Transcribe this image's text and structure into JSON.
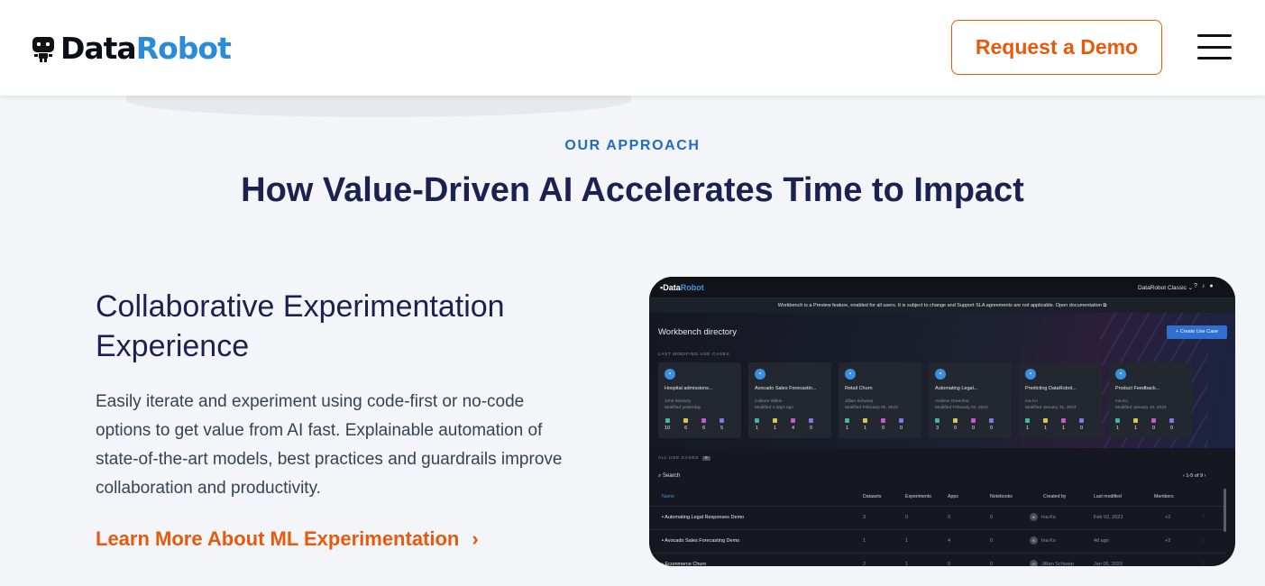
{
  "header": {
    "logo_data": "Data",
    "logo_robot": "Robot",
    "demo_button": "Request a Demo"
  },
  "section": {
    "eyebrow": "OUR APPROACH",
    "heading": "How Value-Driven AI Accelerates Time to Impact"
  },
  "feature": {
    "title": "Collaborative Experimentation Experience",
    "body": "Easily iterate and experiment using code-first or no-code options to get value from AI fast. Explainable automation of state-of-the-art models, best practices and guardrails improve collaboration and productivity.",
    "link": "Learn More About ML Experimentation",
    "link_chevron": "›"
  },
  "screenshot": {
    "logo_data": "Data",
    "logo_robot": "Robot",
    "classic": "DataRobot Classic ⌄",
    "banner": "Workbench is a Preview feature, enabled for all users. It is subject to change and Support SLA agreements are not applicable.    Open documentation ⧉",
    "title": "Workbench directory",
    "create_button": "+  Create Use Case",
    "last_modified_label": "LAST MODIFIED USE CASES",
    "cards": [
      {
        "name": "Hospital admissions...",
        "owner": "John Moriarty",
        "modified": "Modified yesterday",
        "stats": [
          "10",
          "6",
          "6",
          "5"
        ]
      },
      {
        "name": "Avocado Sales Forecastin...",
        "owner": "Colleen Wilkie",
        "modified": "Modified 4 days ago",
        "stats": [
          "1",
          "1",
          "4",
          "0"
        ]
      },
      {
        "name": "Retail Churn",
        "owner": "Jillian Schwiep",
        "modified": "Modified February 06, 2023",
        "stats": [
          "1",
          "1",
          "0",
          "0"
        ]
      },
      {
        "name": "Automating Legal...",
        "owner": "Andrew Greenhut",
        "modified": "Modified February 02, 2023",
        "stats": [
          "3",
          "0",
          "0",
          "0"
        ]
      },
      {
        "name": "Predicting DataRobot...",
        "owner": "Ina Ko",
        "modified": "Modified January 31, 2023",
        "stats": [
          "1",
          "1",
          "1",
          "0"
        ]
      },
      {
        "name": "Product Feedback...",
        "owner": "Ina Ko",
        "modified": "Modified January 10, 2023",
        "stats": [
          "1",
          "1",
          "0",
          "0"
        ]
      }
    ],
    "stat_colors": [
      "#3fb8a8",
      "#d8c84a",
      "#c05ad0",
      "#7a7ae0"
    ],
    "all_label": "ALL USE CASES",
    "all_count": "9",
    "search": "⌕ Search",
    "pager": "‹    1-5 of 9    ›",
    "columns": [
      "Name",
      "Datasets",
      "Experiments",
      "Apps",
      "Notebooks",
      "Created by",
      "Last modified",
      "Members"
    ],
    "rows": [
      {
        "name": "Automating Legal Responses Demo",
        "datasets": "3",
        "experiments": "0",
        "apps": "0",
        "notebooks": "0",
        "creator": "Ina Ko",
        "creator_initials": "IK",
        "modified": "Feb 02, 2023",
        "members": "+2"
      },
      {
        "name": "Avocado Sales Forecasting Demo",
        "datasets": "1",
        "experiments": "1",
        "apps": "4",
        "notebooks": "0",
        "creator": "Ina Ko",
        "creator_initials": "IK",
        "modified": "4d ago",
        "members": "+2"
      },
      {
        "name": "Ecommerce Churn",
        "datasets": "2",
        "experiments": "1",
        "apps": "0",
        "notebooks": "0",
        "creator": "Jillian Schwiep",
        "creator_initials": "JS",
        "modified": "Jan 06, 2023",
        "members": ""
      }
    ]
  }
}
